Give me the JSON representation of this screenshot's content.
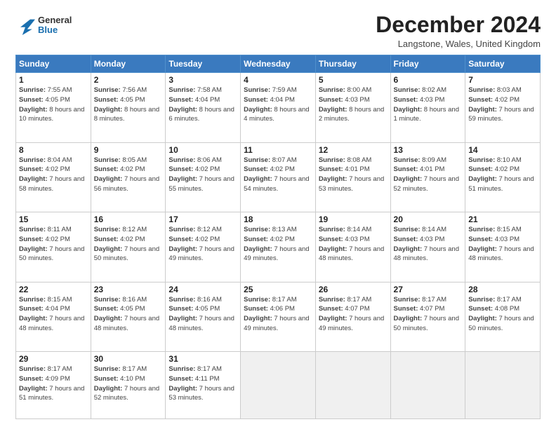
{
  "header": {
    "title": "December 2024",
    "location": "Langstone, Wales, United Kingdom",
    "logo_general": "General",
    "logo_blue": "Blue"
  },
  "days_of_week": [
    "Sunday",
    "Monday",
    "Tuesday",
    "Wednesday",
    "Thursday",
    "Friday",
    "Saturday"
  ],
  "weeks": [
    [
      {
        "day": "1",
        "info": "Sunrise: 7:55 AM\nSunset: 4:05 PM\nDaylight: 8 hours and 10 minutes."
      },
      {
        "day": "2",
        "info": "Sunrise: 7:56 AM\nSunset: 4:05 PM\nDaylight: 8 hours and 8 minutes."
      },
      {
        "day": "3",
        "info": "Sunrise: 7:58 AM\nSunset: 4:04 PM\nDaylight: 8 hours and 6 minutes."
      },
      {
        "day": "4",
        "info": "Sunrise: 7:59 AM\nSunset: 4:04 PM\nDaylight: 8 hours and 4 minutes."
      },
      {
        "day": "5",
        "info": "Sunrise: 8:00 AM\nSunset: 4:03 PM\nDaylight: 8 hours and 2 minutes."
      },
      {
        "day": "6",
        "info": "Sunrise: 8:02 AM\nSunset: 4:03 PM\nDaylight: 8 hours and 1 minute."
      },
      {
        "day": "7",
        "info": "Sunrise: 8:03 AM\nSunset: 4:02 PM\nDaylight: 7 hours and 59 minutes."
      }
    ],
    [
      {
        "day": "8",
        "info": "Sunrise: 8:04 AM\nSunset: 4:02 PM\nDaylight: 7 hours and 58 minutes."
      },
      {
        "day": "9",
        "info": "Sunrise: 8:05 AM\nSunset: 4:02 PM\nDaylight: 7 hours and 56 minutes."
      },
      {
        "day": "10",
        "info": "Sunrise: 8:06 AM\nSunset: 4:02 PM\nDaylight: 7 hours and 55 minutes."
      },
      {
        "day": "11",
        "info": "Sunrise: 8:07 AM\nSunset: 4:02 PM\nDaylight: 7 hours and 54 minutes."
      },
      {
        "day": "12",
        "info": "Sunrise: 8:08 AM\nSunset: 4:01 PM\nDaylight: 7 hours and 53 minutes."
      },
      {
        "day": "13",
        "info": "Sunrise: 8:09 AM\nSunset: 4:01 PM\nDaylight: 7 hours and 52 minutes."
      },
      {
        "day": "14",
        "info": "Sunrise: 8:10 AM\nSunset: 4:02 PM\nDaylight: 7 hours and 51 minutes."
      }
    ],
    [
      {
        "day": "15",
        "info": "Sunrise: 8:11 AM\nSunset: 4:02 PM\nDaylight: 7 hours and 50 minutes."
      },
      {
        "day": "16",
        "info": "Sunrise: 8:12 AM\nSunset: 4:02 PM\nDaylight: 7 hours and 50 minutes."
      },
      {
        "day": "17",
        "info": "Sunrise: 8:12 AM\nSunset: 4:02 PM\nDaylight: 7 hours and 49 minutes."
      },
      {
        "day": "18",
        "info": "Sunrise: 8:13 AM\nSunset: 4:02 PM\nDaylight: 7 hours and 49 minutes."
      },
      {
        "day": "19",
        "info": "Sunrise: 8:14 AM\nSunset: 4:03 PM\nDaylight: 7 hours and 48 minutes."
      },
      {
        "day": "20",
        "info": "Sunrise: 8:14 AM\nSunset: 4:03 PM\nDaylight: 7 hours and 48 minutes."
      },
      {
        "day": "21",
        "info": "Sunrise: 8:15 AM\nSunset: 4:03 PM\nDaylight: 7 hours and 48 minutes."
      }
    ],
    [
      {
        "day": "22",
        "info": "Sunrise: 8:15 AM\nSunset: 4:04 PM\nDaylight: 7 hours and 48 minutes."
      },
      {
        "day": "23",
        "info": "Sunrise: 8:16 AM\nSunset: 4:05 PM\nDaylight: 7 hours and 48 minutes."
      },
      {
        "day": "24",
        "info": "Sunrise: 8:16 AM\nSunset: 4:05 PM\nDaylight: 7 hours and 48 minutes."
      },
      {
        "day": "25",
        "info": "Sunrise: 8:17 AM\nSunset: 4:06 PM\nDaylight: 7 hours and 49 minutes."
      },
      {
        "day": "26",
        "info": "Sunrise: 8:17 AM\nSunset: 4:07 PM\nDaylight: 7 hours and 49 minutes."
      },
      {
        "day": "27",
        "info": "Sunrise: 8:17 AM\nSunset: 4:07 PM\nDaylight: 7 hours and 50 minutes."
      },
      {
        "day": "28",
        "info": "Sunrise: 8:17 AM\nSunset: 4:08 PM\nDaylight: 7 hours and 50 minutes."
      }
    ],
    [
      {
        "day": "29",
        "info": "Sunrise: 8:17 AM\nSunset: 4:09 PM\nDaylight: 7 hours and 51 minutes."
      },
      {
        "day": "30",
        "info": "Sunrise: 8:17 AM\nSunset: 4:10 PM\nDaylight: 7 hours and 52 minutes."
      },
      {
        "day": "31",
        "info": "Sunrise: 8:17 AM\nSunset: 4:11 PM\nDaylight: 7 hours and 53 minutes."
      },
      {
        "day": "",
        "info": ""
      },
      {
        "day": "",
        "info": ""
      },
      {
        "day": "",
        "info": ""
      },
      {
        "day": "",
        "info": ""
      }
    ]
  ]
}
